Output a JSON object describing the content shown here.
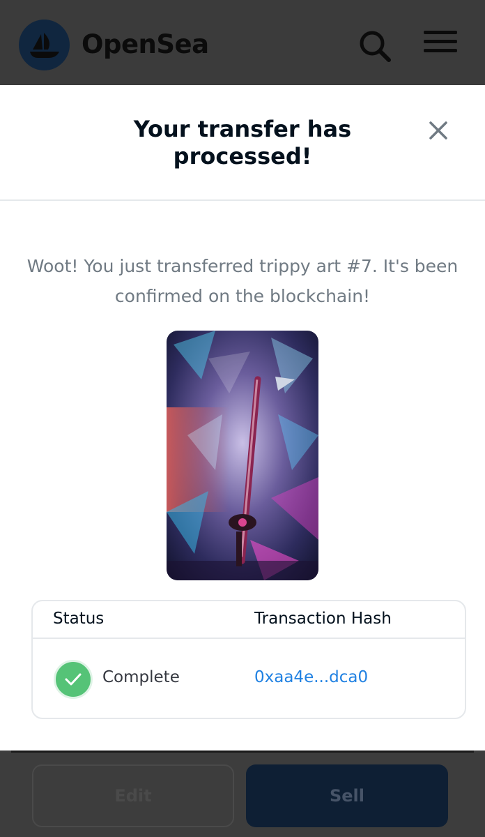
{
  "header": {
    "brand": "OpenSea",
    "logo_icon": "opensea-ship-icon",
    "search_icon": "search-icon",
    "menu_icon": "hamburger-menu-icon"
  },
  "modal": {
    "title": "Your transfer has processed!",
    "close_icon": "close-icon",
    "message": "Woot! You just transferred trippy art #7. It's been confirmed on the blockchain!",
    "image_subject": "trippy art #7",
    "table": {
      "headers": [
        "Status",
        "Transaction Hash"
      ],
      "row": {
        "status": "Complete",
        "status_icon": "check-circle-icon",
        "hash": "0xaa4e...dca0"
      }
    }
  },
  "footer": {
    "edit_label": "Edit",
    "sell_label": "Sell"
  },
  "colors": {
    "link": "#2081e2",
    "success": "#55c377",
    "brand_blue": "#10263f"
  }
}
